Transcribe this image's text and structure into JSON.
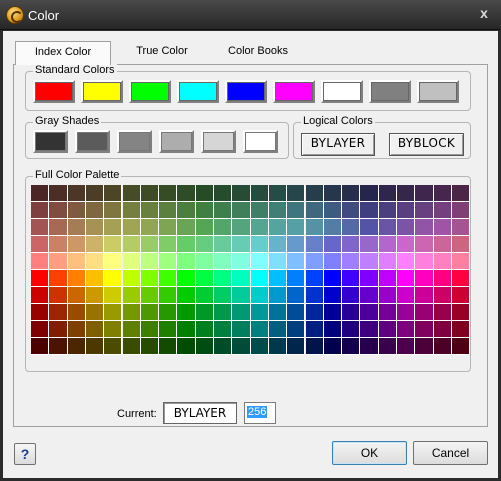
{
  "window": {
    "title": "Color",
    "close_glyph": "x",
    "icon": "app-logo-icon"
  },
  "tabs": [
    {
      "label": "Index Color",
      "active": true
    },
    {
      "label": "True Color",
      "active": false
    },
    {
      "label": "Color Books",
      "active": false
    }
  ],
  "standard_colors": {
    "label": "Standard Colors",
    "swatches": [
      "#ff0000",
      "#ffff00",
      "#00ff00",
      "#00ffff",
      "#0000ff",
      "#ff00ff",
      "#ffffff",
      "#808080",
      "#c0c0c0"
    ]
  },
  "gray_shades": {
    "label": "Gray Shades",
    "swatches": [
      "#333333",
      "#5b5b5b",
      "#848484",
      "#adadad",
      "#d6d6d6",
      "#ffffff"
    ]
  },
  "logical_colors": {
    "label": "Logical Colors",
    "bylayer": "BYLAYER",
    "byblock": "BYBLOCK"
  },
  "palette": {
    "label": "Full Color Palette",
    "columns": 24,
    "rows": [
      [
        "#4c2626",
        "#4c2e26",
        "#4c3626",
        "#4c3e26",
        "#4c4626",
        "#464c26",
        "#3e4c26",
        "#364c26",
        "#2e4c26",
        "#264c26",
        "#264c2e",
        "#264c36",
        "#264c3e",
        "#264c46",
        "#26464c",
        "#263e4c",
        "#26364c",
        "#262e4c",
        "#26264c",
        "#2e264c",
        "#36264c",
        "#3e264c",
        "#46264c",
        "#4c2646"
      ],
      [
        "#7f3f3f",
        "#7f4c3f",
        "#7f5a3f",
        "#7f683f",
        "#7f753f",
        "#757f3f",
        "#687f3f",
        "#5a7f3f",
        "#4c7f3f",
        "#3f7f3f",
        "#3f7f4c",
        "#3f7f5a",
        "#3f7f68",
        "#3f7f75",
        "#3f757f",
        "#3f687f",
        "#3f5a7f",
        "#3f4c7f",
        "#3f3f7f",
        "#4c3f7f",
        "#5a3f7f",
        "#683f7f",
        "#753f7f",
        "#7f3f75"
      ],
      [
        "#a55454",
        "#a56954",
        "#a57d54",
        "#a59254",
        "#a5a054",
        "#a0a554",
        "#92a554",
        "#7da554",
        "#69a554",
        "#54a554",
        "#54a569",
        "#54a57d",
        "#54a592",
        "#54a5a0",
        "#54a0a5",
        "#5492a5",
        "#547da5",
        "#5469a5",
        "#5454a5",
        "#6954a5",
        "#7d54a5",
        "#9254a5",
        "#a054a5",
        "#a55492"
      ],
      [
        "#cc6666",
        "#cc8066",
        "#cc9966",
        "#ccb366",
        "#cccc66",
        "#b3cc66",
        "#99cc66",
        "#80cc66",
        "#66cc66",
        "#66cc80",
        "#66cc99",
        "#66ccb3",
        "#66cccc",
        "#66b3cc",
        "#6699cc",
        "#6680cc",
        "#6666cc",
        "#8066cc",
        "#9966cc",
        "#b366cc",
        "#cc66cc",
        "#cc66b3",
        "#cc6699",
        "#cc6680"
      ],
      [
        "#ff7f7f",
        "#ff9f7f",
        "#ffbf7f",
        "#ffdf7f",
        "#ffff7f",
        "#dfff7f",
        "#bfff7f",
        "#9fff7f",
        "#7fff7f",
        "#7fff9f",
        "#7fffbf",
        "#7fffdf",
        "#7fffff",
        "#7fdfff",
        "#7fbfff",
        "#7f9fff",
        "#7f7fff",
        "#9f7fff",
        "#bf7fff",
        "#df7fff",
        "#ff7fff",
        "#ff7fdf",
        "#ff7fbf",
        "#ff7f9f"
      ],
      [
        "#ff0000",
        "#ff4000",
        "#ff8000",
        "#ffbf00",
        "#ffff00",
        "#bfff00",
        "#80ff00",
        "#40ff00",
        "#00ff00",
        "#00ff40",
        "#00ff80",
        "#00ffbf",
        "#00ffff",
        "#00bfff",
        "#0080ff",
        "#0040ff",
        "#0000ff",
        "#4000ff",
        "#8000ff",
        "#bf00ff",
        "#ff00ff",
        "#ff00bf",
        "#ff0080",
        "#ff0040"
      ],
      [
        "#cc0000",
        "#cc3300",
        "#cc6600",
        "#cc9900",
        "#cccc00",
        "#99cc00",
        "#66cc00",
        "#33cc00",
        "#00cc00",
        "#00cc33",
        "#00cc66",
        "#00cc99",
        "#00cccc",
        "#0099cc",
        "#0066cc",
        "#0033cc",
        "#0000cc",
        "#3300cc",
        "#6600cc",
        "#9900cc",
        "#cc00cc",
        "#cc0099",
        "#cc0066",
        "#cc0033"
      ],
      [
        "#990000",
        "#992600",
        "#994c00",
        "#997300",
        "#999900",
        "#739900",
        "#4c9900",
        "#269900",
        "#009900",
        "#009926",
        "#00994c",
        "#009973",
        "#009999",
        "#007399",
        "#004c99",
        "#002699",
        "#000099",
        "#260099",
        "#4c0099",
        "#730099",
        "#990099",
        "#990073",
        "#99004c",
        "#990026"
      ],
      [
        "#7f0000",
        "#7f1f00",
        "#7f3f00",
        "#7f5f00",
        "#7f7f00",
        "#5f7f00",
        "#3f7f00",
        "#1f7f00",
        "#007f00",
        "#007f1f",
        "#007f3f",
        "#007f5f",
        "#007f7f",
        "#005f7f",
        "#003f7f",
        "#001f7f",
        "#00007f",
        "#1f007f",
        "#3f007f",
        "#5f007f",
        "#7f007f",
        "#7f005f",
        "#7f003f",
        "#7f001f"
      ],
      [
        "#4c0000",
        "#4c1300",
        "#4c2600",
        "#4c3900",
        "#4c4c00",
        "#394c00",
        "#264c00",
        "#134c00",
        "#004c00",
        "#004c13",
        "#004c26",
        "#004c39",
        "#004c4c",
        "#00394c",
        "#00264c",
        "#00134c",
        "#00004c",
        "#13004c",
        "#26004c",
        "#39004c",
        "#4c004c",
        "#4c0039",
        "#4c0026",
        "#4c0013"
      ]
    ]
  },
  "current": {
    "label": "Current:",
    "name": "BYLAYER",
    "index": "256"
  },
  "footer": {
    "help_label": "?",
    "ok_label": "OK",
    "cancel_label": "Cancel"
  }
}
